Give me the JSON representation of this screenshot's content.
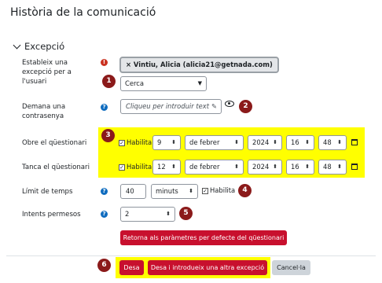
{
  "page": {
    "title": "Història de la comunicació",
    "section": "Excepció"
  },
  "user_override": {
    "label": "Estableix una excepció per a l'usuari",
    "selected_user": "× Vintiu, Alicia (alicia21@getnada.com)",
    "search_value": "Cerca"
  },
  "password": {
    "label": "Demana una contrasenya",
    "placeholder": "Cliqueu per introduir text"
  },
  "open_quiz": {
    "label": "Obre el qüestionari",
    "enable_label": "Habilita",
    "enabled": true,
    "day": "9",
    "month": "de febrer",
    "year": "2024",
    "hour": "16",
    "minute": "48"
  },
  "close_quiz": {
    "label": "Tanca el qüestionari",
    "enable_label": "Habilita",
    "enabled": true,
    "day": "12",
    "month": "de febrer",
    "year": "2024",
    "hour": "16",
    "minute": "48"
  },
  "time_limit": {
    "label": "Límit de temps",
    "value": "40",
    "unit": "minuts",
    "enable_label": "Habilita",
    "enabled": true
  },
  "attempts": {
    "label": "Intents permesos",
    "value": "2"
  },
  "revert_button": "Retorna als paràmetres per defecte del qüestionari",
  "actions": {
    "save": "Desa",
    "save_and_add": "Desa i introdueix una altra excepció",
    "cancel": "Cancel·la"
  },
  "markers": [
    "1",
    "2",
    "3",
    "4",
    "5",
    "6"
  ],
  "colors": {
    "highlight": "#ffff00",
    "primary_red": "#c8102e",
    "marker": "#8b1a1a",
    "required": "#ca3120",
    "help": "#0f6cbf"
  },
  "icons": [
    "chevron-down-icon",
    "required-icon",
    "help-icon",
    "pencil-icon",
    "eye-icon",
    "calendar-icon",
    "dropdown-arrow-icon"
  ]
}
